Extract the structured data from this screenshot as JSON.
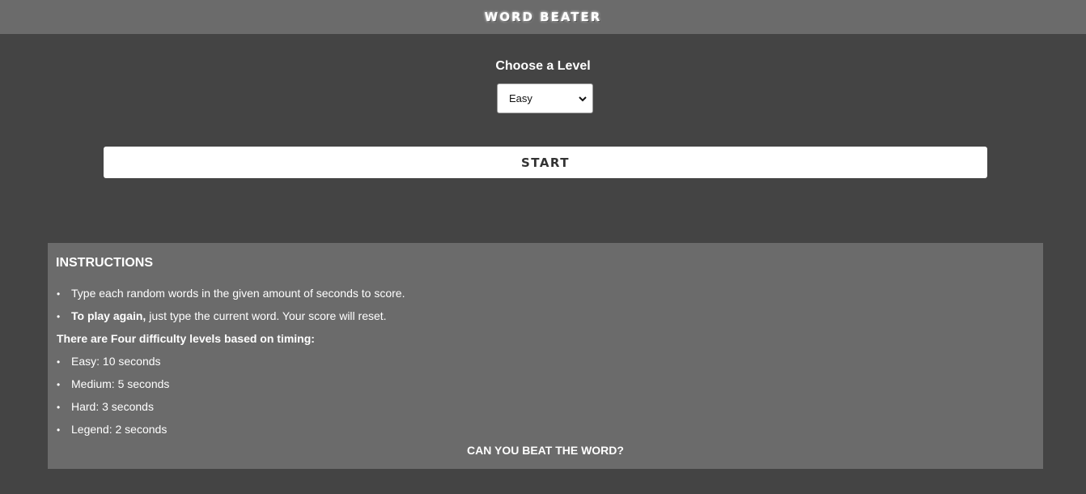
{
  "header": {
    "title": "WORD BEATER"
  },
  "level": {
    "label": "Choose a Level",
    "selected": "Easy"
  },
  "start_label": "START",
  "instructions": {
    "heading": "INSTRUCTIONS",
    "rule1": "Type each random words in the given amount of seconds to score.",
    "rule2_bold": "To play again,",
    "rule2_rest": " just type the current word. Your score will reset.",
    "levels_intro": "There are Four difficulty levels based on timing:",
    "levels": [
      "Easy: 10 seconds",
      "Medium: 5 seconds",
      "Hard: 3 seconds",
      "Legend: 2 seconds"
    ],
    "closing": "CAN YOU BEAT THE WORD?"
  }
}
